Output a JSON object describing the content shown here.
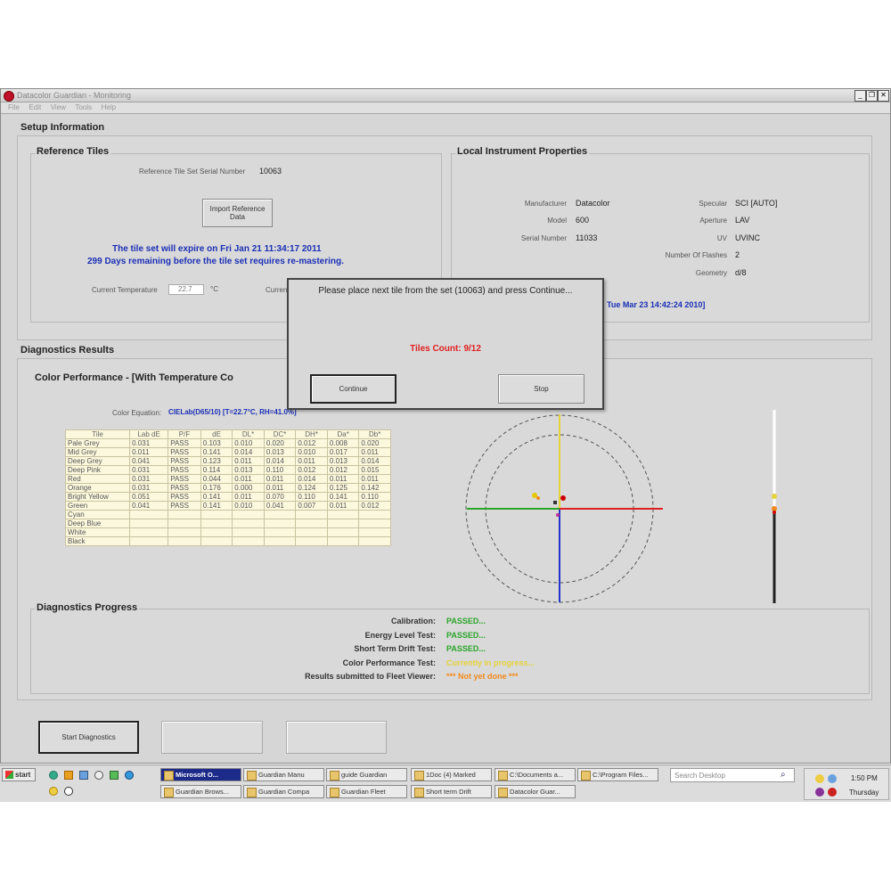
{
  "window": {
    "title": "Datacolor Guardian - Monitoring",
    "controls": [
      "_",
      "❐",
      "✕"
    ]
  },
  "menu": [
    "File",
    "Edit",
    "View",
    "Tools",
    "Help"
  ],
  "setup": {
    "heading": "Setup Information",
    "reference": {
      "heading": "Reference Tiles",
      "serial_label": "Reference Tile Set Serial Number",
      "serial_value": "10063",
      "import_button": "Import Reference Data",
      "expire_line1": "The tile set will expire on Fri Jan 21 11:34:17 2011",
      "expire_line2": "299 Days remaining before the tile set requires re-mastering.",
      "temp_label": "Current Temperature",
      "temp_value": "22.7",
      "temp_unit": "°C",
      "current_label": "Current"
    },
    "local": {
      "heading": "Local Instrument Properties",
      "left": [
        {
          "label": "Manufacturer",
          "value": "Datacolor"
        },
        {
          "label": "Model",
          "value": "600"
        },
        {
          "label": "Serial Number",
          "value": "11033"
        }
      ],
      "right": [
        {
          "label": "Specular",
          "value": "SCI [AUTO]"
        },
        {
          "label": "Aperture",
          "value": "LAV"
        },
        {
          "label": "UV",
          "value": "UVINC"
        },
        {
          "label": "Number Of Flashes",
          "value": "2"
        },
        {
          "label": "Geometry",
          "value": "d/8"
        }
      ],
      "date_text": "Tue Mar 23 14:42:24 2010]"
    }
  },
  "diagnostics": {
    "heading": "Diagnostics Results",
    "color_perf_heading": "Color Performance - [With Temperature Co",
    "equation_label": "Color Equation:",
    "equation_value": "CIELab(D65/10) [T=22.7°C, RH=41.0%]",
    "table": {
      "headers": [
        "Tile",
        "Lab dE",
        "P/F",
        "dE",
        "DL*",
        "DC*",
        "DH*",
        "Da*",
        "Db*"
      ],
      "rows": [
        [
          "Pale Grey",
          "0.031",
          "PASS",
          "0.103",
          "0.010",
          "0.020",
          "0.012",
          "0.008",
          "0.020"
        ],
        [
          "Mid Grey",
          "0.011",
          "PASS",
          "0.141",
          "0.014",
          "0.013",
          "0.010",
          "0.017",
          "0.011"
        ],
        [
          "Deep Grey",
          "0.041",
          "PASS",
          "0.123",
          "0.011",
          "0.014",
          "0.011",
          "0.013",
          "0.014"
        ],
        [
          "Deep Pink",
          "0.031",
          "PASS",
          "0.114",
          "0.013",
          "0.110",
          "0.012",
          "0.012",
          "0.015"
        ],
        [
          "Red",
          "0.031",
          "PASS",
          "0.044",
          "0.011",
          "0.011",
          "0.014",
          "0.011",
          "0.011"
        ],
        [
          "Orange",
          "0.031",
          "PASS",
          "0.176",
          "0.000",
          "0.011",
          "0.124",
          "0.125",
          "0.142"
        ],
        [
          "Bright Yellow",
          "0.051",
          "PASS",
          "0.141",
          "0.011",
          "0.070",
          "0.110",
          "0.141",
          "0.110"
        ],
        [
          "Green",
          "0.041",
          "PASS",
          "0.141",
          "0.010",
          "0.041",
          "0.007",
          "0.011",
          "0.012"
        ],
        [
          "Cyan",
          "",
          "",
          "",
          "",
          "",
          "",
          "",
          ""
        ],
        [
          "Deep Blue",
          "",
          "",
          "",
          "",
          "",
          "",
          "",
          ""
        ],
        [
          "White",
          "",
          "",
          "",
          "",
          "",
          "",
          "",
          ""
        ],
        [
          "Black",
          "",
          "",
          "",
          "",
          "",
          "",
          "",
          ""
        ]
      ]
    }
  },
  "progress": {
    "heading": "Diagnostics Progress",
    "items": [
      {
        "label": "Calibration:",
        "status": "PASSED...",
        "color": "#2aa52a"
      },
      {
        "label": "Energy Level Test:",
        "status": "PASSED...",
        "color": "#2aa52a"
      },
      {
        "label": "Short Term Drift Test:",
        "status": "PASSED...",
        "color": "#2aa52a"
      },
      {
        "label": "Color Performance Test:",
        "status": "Currently in progress...",
        "color": "#e6d23a"
      },
      {
        "label": "Results submitted to Fleet Viewer:",
        "status": "*** Not yet done ***",
        "color": "#f08a1e"
      }
    ]
  },
  "bottom_buttons": {
    "start": "Start Diagnostics",
    "b2": "",
    "b3": ""
  },
  "dialog": {
    "message": "Please place next tile from the set (10063) and press Continue...",
    "count": "Tiles Count: 9/12",
    "continue": "Continue",
    "stop": "Stop"
  },
  "taskbar": {
    "start": "start",
    "row1": [
      "Microsoft O...",
      "Guardian Manu",
      "guide Guardian",
      "1Doc (4) Marked",
      "C:\\Documents a...",
      "C:\\Program Files..."
    ],
    "row2": [
      "Guardian Brows...",
      "Guardian Compa",
      "Guardian Fleet",
      "Short term Drift",
      "Datacolor Guar..."
    ],
    "search_placeholder": "Search Desktop",
    "clock_time": "1:50 PM",
    "clock_day": "Thursday"
  },
  "colors": {
    "accent_blue": "#1a2fb5",
    "alert_red": "#e02020",
    "pass_green": "#2aa52a",
    "progress_yellow": "#e6d23a",
    "pending_orange": "#f08a1e"
  }
}
